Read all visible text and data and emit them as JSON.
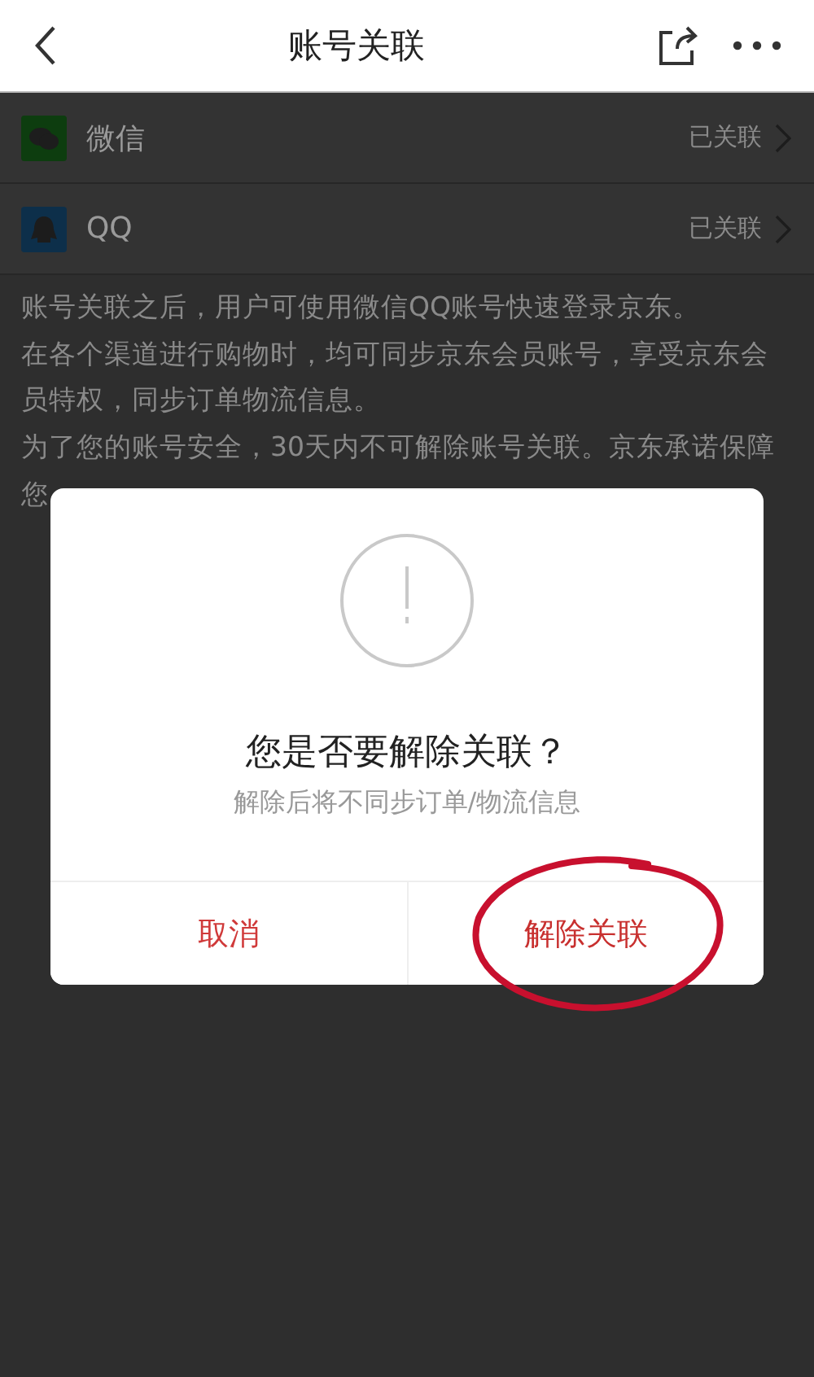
{
  "header": {
    "title": "账号关联"
  },
  "accounts": [
    {
      "kind": "wechat",
      "name": "微信",
      "status": "已关联"
    },
    {
      "kind": "qq",
      "name": "QQ",
      "status": "已关联"
    }
  ],
  "notice": [
    "账号关联之后，用户可使用微信QQ账号快速登录京东。",
    "在各个渠道进行购物时，均可同步京东会员账号，享受京东会员特权，同步订单物流信息。",
    "为了您的账号安全，30天内不可解除账号关联。京东承诺保障您"
  ],
  "dialog": {
    "title": "您是否要解除关联？",
    "message": "解除后将不同步订单/物流信息",
    "buttons": [
      {
        "label": "取消",
        "highlighted": false
      },
      {
        "label": "解除关联",
        "highlighted": true
      }
    ]
  }
}
